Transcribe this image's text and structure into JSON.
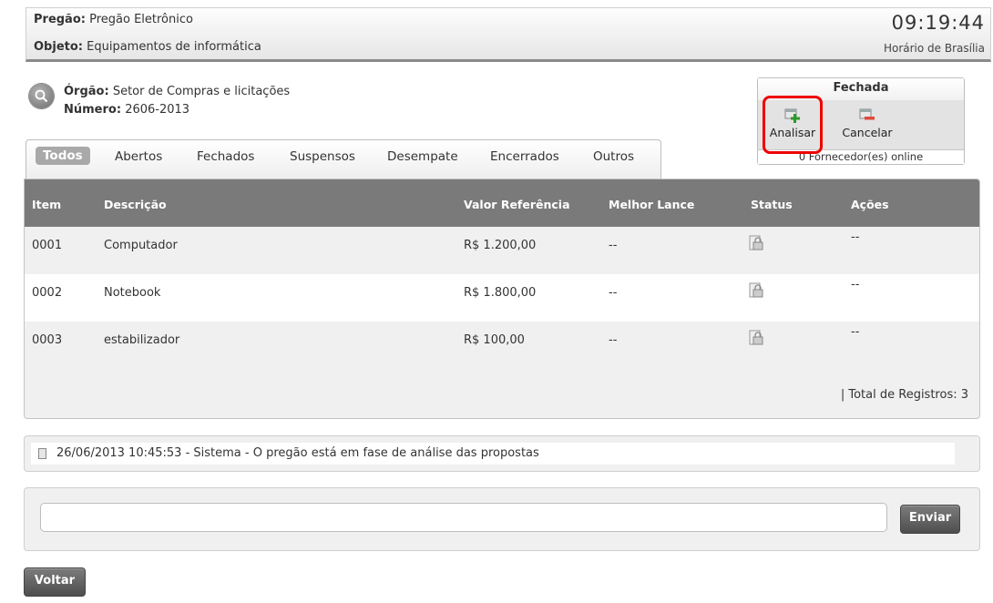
{
  "header": {
    "pregao_label": "Pregão:",
    "pregao_value": "Pregão Eletrônico",
    "objeto_label": "Objeto:",
    "objeto_value": "Equipamentos de informática",
    "clock": "09:19:44",
    "timezone": "Horário de Brasília"
  },
  "info": {
    "orgao_label": "Órgão:",
    "orgao_value": "Setor de Compras e licitações",
    "numero_label": "Número:",
    "numero_value": "2606-2013"
  },
  "status_box": {
    "title": "Fechada",
    "analisar_label": "Analisar",
    "cancelar_label": "Cancelar",
    "fornecedores": "0 Fornecedor(es) online"
  },
  "tabs": [
    "Todos",
    "Abertos",
    "Fechados",
    "Suspensos",
    "Desempate",
    "Encerrados",
    "Outros"
  ],
  "table": {
    "columns": [
      "Item",
      "Descrição",
      "Valor Referência",
      "Melhor Lance",
      "Status",
      "Ações"
    ],
    "rows": [
      {
        "item": "0001",
        "descricao": "Computador",
        "valor": "R$ 1.200,00",
        "lance": "--",
        "acoes": "--"
      },
      {
        "item": "0002",
        "descricao": "Notebook",
        "valor": "R$ 1.800,00",
        "lance": "--",
        "acoes": "--"
      },
      {
        "item": "0003",
        "descricao": "estabilizador",
        "valor": "R$ 100,00",
        "lance": "--",
        "acoes": "--"
      }
    ],
    "total": "| Total de Registros: 3"
  },
  "messages": [
    "26/06/2013 10:45:53 - Sistema - O pregão está em fase de análise das propostas"
  ],
  "send": {
    "input_value": "",
    "button_label": "Enviar"
  },
  "voltar_label": "Voltar",
  "colors": {
    "table_header": "#7a7a7a",
    "highlight": "#e00000",
    "button": "#5e5e5e"
  },
  "icons": {
    "orgao": "magnifier-icon",
    "analisar": "add-plus-icon",
    "cancelar": "cancel-minus-icon",
    "status": "lock-document-icon",
    "message": "document-icon"
  }
}
